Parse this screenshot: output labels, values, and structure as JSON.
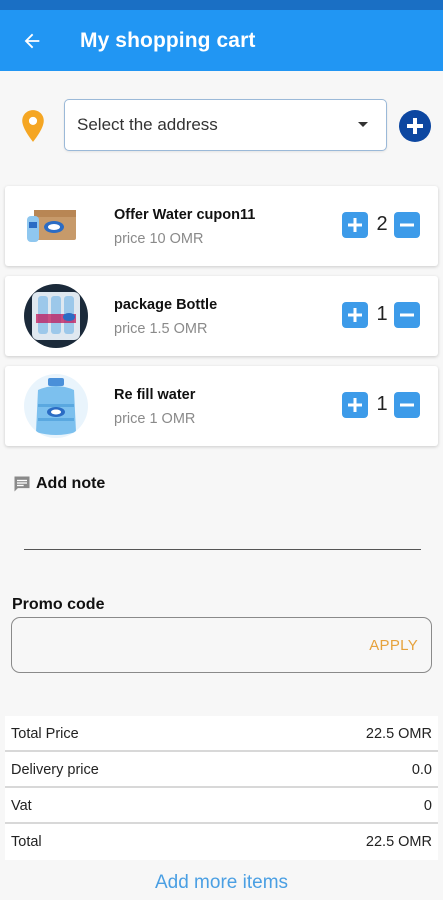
{
  "header": {
    "title": "My shopping cart"
  },
  "address": {
    "placeholder": "Select the address"
  },
  "cart": {
    "items": [
      {
        "name": "Offer Water cupon11",
        "price": "price 10 OMR",
        "quantity": "2"
      },
      {
        "name": "package Bottle",
        "price": "price 1.5 OMR",
        "quantity": "1"
      },
      {
        "name": "Re fill water",
        "price": "price 1 OMR",
        "quantity": "1"
      }
    ]
  },
  "note": {
    "label": "Add note"
  },
  "promo": {
    "label": "Promo code",
    "apply_label": "APPLY"
  },
  "totals": {
    "rows": [
      {
        "label": "Total Price",
        "value": "22.5 OMR"
      },
      {
        "label": "Delivery price",
        "value": "0.0"
      },
      {
        "label": "Vat",
        "value": "0"
      },
      {
        "label": "Total",
        "value": "22.5 OMR"
      }
    ]
  },
  "actions": {
    "add_more": "Add more items"
  },
  "colors": {
    "primary": "#2196f3",
    "status_bar": "#1a6fc4",
    "qty_button": "#3d9be9",
    "add_address": "#0d47a1",
    "pin": "#f5a623",
    "apply": "#e6a23c",
    "link": "#4a9fe3"
  },
  "icons": {
    "back": "arrow-left-icon",
    "location": "location-pin-icon",
    "dropdown": "caret-down-icon",
    "add_address": "plus-circle-icon",
    "increase": "plus-icon",
    "decrease": "minus-icon",
    "note": "comment-icon"
  }
}
